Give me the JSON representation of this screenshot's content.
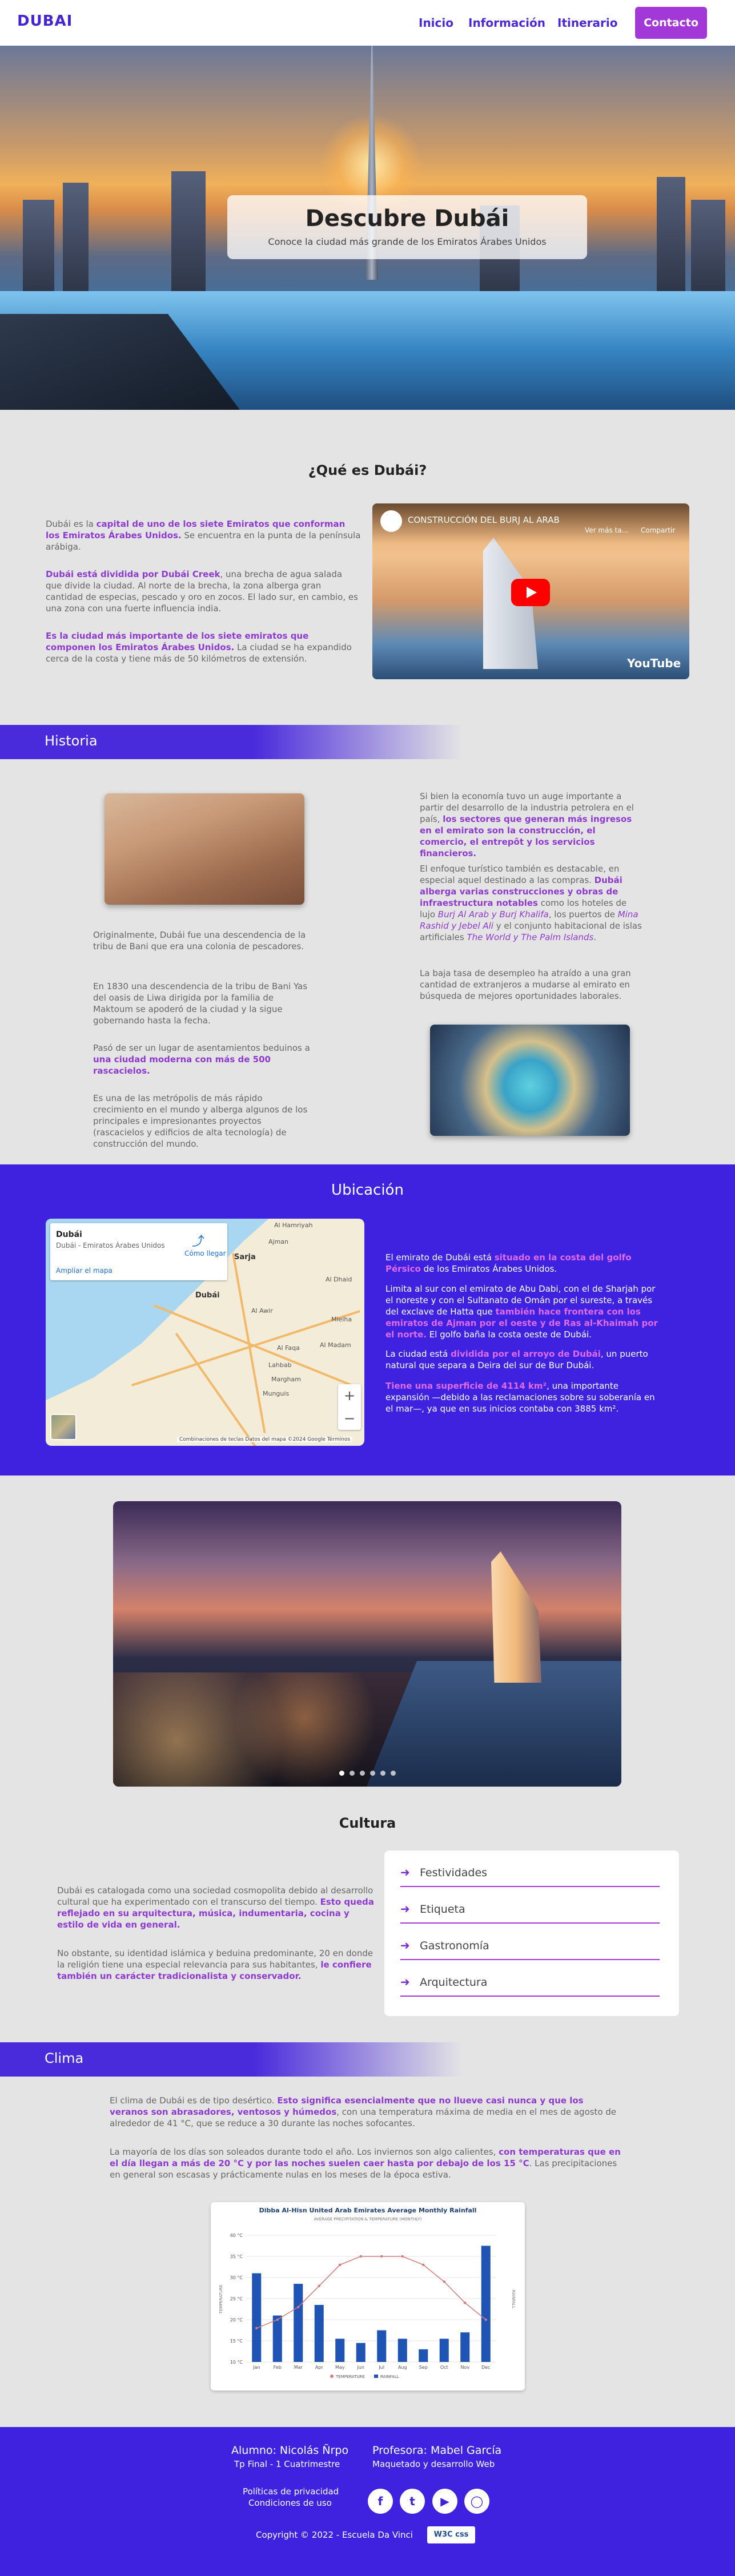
{
  "nav": {
    "logo": "DUBAI",
    "links": [
      "Inicio",
      "Información",
      "Itinerario"
    ],
    "contact": "Contacto"
  },
  "hero": {
    "title": "Descubre Dubái",
    "subtitle": "Conoce la ciudad más grande de los Emiratos Árabes Unidos"
  },
  "que_es": {
    "title": "¿Qué es Dubái?",
    "p1a": "Dubái es la ",
    "p1b": "capital de uno de los siete Emiratos que conforman los Emiratos Árabes Unidos.",
    "p1c": " Se encuentra en la punta de la península arábiga.",
    "p2a": "Dubái está dividida por Dubái Creek",
    "p2b": ", una brecha de agua salada que divide la ciudad. Al norte de la brecha, la zona alberga gran cantidad de especias, pescado y oro en zocos. El lado sur, en cambio, es una zona con una fuerte influencia india.",
    "p3a": "Es la ciudad más importante de los siete emiratos que componen los Emiratos Árabes Unidos.",
    "p3b": " La ciudad se ha expandido cerca de la costa y tiene más de 50 kilómetros de extensión."
  },
  "video": {
    "title": "CONSTRUCCIÓN DEL BURJ AL ARAB",
    "watch_later": "Ver más ta...",
    "share": "Compartir",
    "brand": "YouTube"
  },
  "historia": {
    "title": "Historia",
    "l1": "Originalmente, Dubái fue una descendencia de la tribu de Bani que era una colonia de pescadores.",
    "l2": "En 1830 una descendencia de la tribu de Bani Yas del oasis de Liwa dirigida por la familia de Maktoum se apoderó de la ciudad y la sigue gobernando hasta la fecha.",
    "l3a": "Pasó de ser un lugar de asentamientos beduinos a ",
    "l3b": "una ciudad moderna con más de 500 rascacielos.",
    "l4": "Es una de las metrópolis de más rápido crecimiento en el mundo y alberga algunos de los principales e impresionantes proyectos (rascacielos y edificios de alta tecnología) de construcción del mundo.",
    "r1a": "Si bien la economía tuvo un auge importante a partir del desarrollo de la industria petrolera en el país, ",
    "r1b": "los sectores que generan más ingresos en el emirato son la construcción, el comercio, el entrepôt y los servicios financieros.",
    "r2a": "El enfoque turístico también es destacable, en especial aquel destinado a las compras. ",
    "r2b": "Dubái alberga varias construcciones y obras de infraestructura notables",
    "r2c": " como los hoteles de lujo ",
    "r2d": "Burj Al Arab y Burj Khalifa",
    "r2e": ", los puertos de ",
    "r2f": "Mina Rashid y Jebel Ali",
    "r2g": " y el conjunto habitacional de islas artificiales ",
    "r2h": "The World y The Palm Islands",
    "r2i": ".",
    "r3": "La baja tasa de desempleo ha atraído a una gran cantidad de extranjeros a mudarse al emirato en búsqueda de mejores oportunidades laborales."
  },
  "ubicacion": {
    "title": "Ubicación",
    "map_name": "Dubái",
    "map_addr": "Dubái - Emiratos Árabes Unidos",
    "map_route": "Cómo llegar",
    "map_enlarge": "Ampliar el mapa",
    "map_credits": "Combinaciones de teclas   Datos del mapa ©2024 Google   Términos",
    "cities": [
      "Sarja",
      "Ajman",
      "Al Dhaid",
      "Dubái",
      "Al Awir",
      "Al Faqa",
      "Lahbab",
      "Margham",
      "Mleiha",
      "Al Madam",
      "Al Hamriyah",
      "Munguis"
    ],
    "p1a": "El emirato de Dubái está ",
    "p1b": "situado en la costa del golfo Pérsico",
    "p1c": " de los Emiratos Árabes Unidos.",
    "p2a": "Limita al sur con el emirato de Abu Dabi, con el de Sharjah por el noreste y con el Sultanato de Omán por el sureste, a través del exclave de Hatta que ",
    "p2b": "también hace frontera con los emiratos de Ajman por el oeste y de Ras al-Khaimah por el norte.",
    "p2c": " El golfo baña la costa oeste de Dubái.",
    "p3a": "La ciudad está ",
    "p3b": "dividida por el arroyo de Dubái",
    "p3c": ", un puerto natural que separa a Deira del sur de Bur Dubái.",
    "p4a": "Tiene una superficie de 4114 km²",
    "p4b": ", una importante expansión —debido a las reclamaciones sobre su soberanía en el mar—, ya que en sus inicios contaba con 3885 km²."
  },
  "cultura": {
    "title": "Cultura",
    "p1a": "Dubái es catalogada como una sociedad cosmopolita debido al desarrollo cultural que ha experimentado con el transcurso del tiempo. ",
    "p1b": "Esto queda reflejado en su arquitectura, música, indumentaria, cocina y estilo de vida en general.",
    "p2a": "No obstante, su identidad islámica y beduina predominante, 20 en donde la religión tiene una especial relevancia para sus habitantes, ",
    "p2b": "le confiere también un carácter tradicionalista y conservador.",
    "items": [
      "Festividades",
      "Etiqueta",
      "Gastronomía",
      "Arquitectura"
    ]
  },
  "clima": {
    "title": "Clima",
    "p1a": "El clima de Dubái es de tipo desértico. ",
    "p1b": "Esto significa esencialmente que no llueve casi nunca y que los veranos son abrasadores, ventosos y húmedos",
    "p1c": ", con una temperatura máxima de media en el mes de agosto de alrededor de 41 °C, que se reduce a 30 durante las noches sofocantes.",
    "p2a": "La mayoría de los días son soleados durante todo el año. Los inviernos son algo calientes, ",
    "p2b": "con temperaturas que en el día llegan a más de 20 °C y por las noches suelen caer hasta por debajo de los 15 °C",
    "p2c": ". Las precipitaciones en general son escasas y prácticamente nulas en los meses de la época estiva."
  },
  "chart_data": {
    "type": "bar",
    "title": "Dibba Al-Hisn United Arab Emirates Average Monthly Rainfall",
    "subtitle": "AVERAGE PRECIPITATION & TEMPERATURE (MONTHLY)",
    "categories": [
      "Jan",
      "Feb",
      "Mar",
      "Apr",
      "May",
      "Jun",
      "Jul",
      "Aug",
      "Sep",
      "Oct",
      "Nov",
      "Dec"
    ],
    "series": [
      {
        "name": "RAINFALL",
        "values": [
          42,
          22,
          37,
          27,
          11,
          9,
          15,
          11,
          6,
          11,
          14,
          55
        ]
      },
      {
        "name": "TEMPERATURE",
        "values": [
          18,
          20,
          23,
          28,
          33,
          35,
          35,
          35,
          33,
          29,
          24,
          20
        ]
      }
    ],
    "ylabel": "TEMPERATURE",
    "y2label": "RAINFALL",
    "y_ticks": [
      "10 °C",
      "15 °C",
      "20 °C",
      "25 °C",
      "30 °C",
      "35 °C",
      "40 °C"
    ],
    "legend": [
      "TEMPERATURE",
      "RAINFALL"
    ],
    "legend_position": "bottom",
    "colors": {
      "bars": "#1f54b5",
      "line": "#d67b7b"
    }
  },
  "footer": {
    "student": "Alumno: Nicolás Ñrpo",
    "student_sub": "Tp Final - 1 Cuatrimestre",
    "teacher": "Profesora: Mabel García",
    "teacher_sub": "Maquetado y desarrollo Web",
    "privacy": "Políticas de privacidad",
    "terms": "Condiciones de uso",
    "social": [
      "facebook-icon",
      "twitter-icon",
      "youtube-icon",
      "instagram-icon"
    ],
    "copyright": "Copyright © 2022 - Escuela Da Vinci",
    "w3c": "W3C css"
  }
}
